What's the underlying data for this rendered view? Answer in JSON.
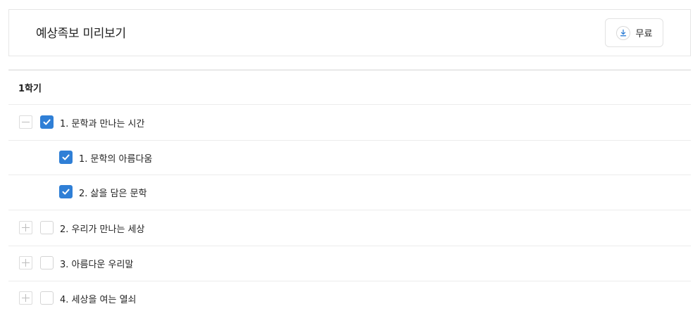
{
  "header": {
    "title": "예상족보 미리보기",
    "download_label": "무료"
  },
  "semester": {
    "label": "1학기"
  },
  "chapters": [
    {
      "label": "1. 문학과 만나는 시간",
      "expanded": true,
      "checked": true
    },
    {
      "label": "1. 문학의 아름다움",
      "sub": true,
      "checked": true
    },
    {
      "label": "2. 삶을 담은 문학",
      "sub": true,
      "checked": true
    },
    {
      "label": "2. 우리가 만나는 세상",
      "expanded": false,
      "checked": false
    },
    {
      "label": "3. 아름다운 우리말",
      "expanded": false,
      "checked": false
    },
    {
      "label": "4. 세상을 여는 열쇠",
      "expanded": false,
      "checked": false
    }
  ],
  "colors": {
    "accent": "#2f7fd6",
    "border": "#e6e6e6"
  }
}
